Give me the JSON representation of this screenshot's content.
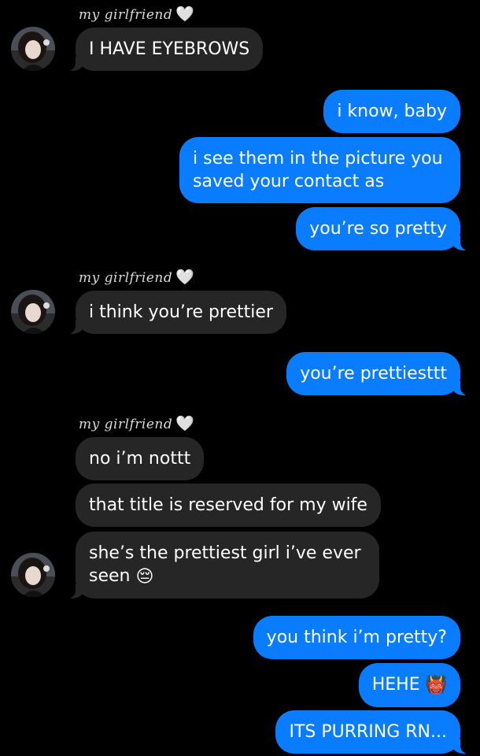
{
  "chat": {
    "sender_name": "my girlfriend",
    "heart": "🤍",
    "messages": [
      {
        "from": "them",
        "text": "I HAVE EYEBROWS"
      },
      {
        "from": "me",
        "text": "i know, baby"
      },
      {
        "from": "me",
        "text": "i see them in the picture you saved your contact as"
      },
      {
        "from": "me",
        "text": "you’re so pretty"
      },
      {
        "from": "them",
        "text": "i think you’re prettier"
      },
      {
        "from": "me",
        "text": "you’re prettiesttt"
      },
      {
        "from": "them",
        "text": "no i’m nottt"
      },
      {
        "from": "them",
        "text": "that title is reserved for my wife"
      },
      {
        "from": "them",
        "text": "she’s the prettiest girl i’ve ever seen",
        "emoji": "😔"
      },
      {
        "from": "me",
        "text": "you think i’m pretty?"
      },
      {
        "from": "me",
        "text": "HEHE",
        "emoji": "👹"
      },
      {
        "from": "me",
        "text": "ITS PURRING RN..."
      }
    ]
  },
  "colors": {
    "background": "#000000",
    "incoming_bubble": "#262626",
    "outgoing_bubble": "#0a7cff",
    "text": "#ffffff"
  },
  "icons": {
    "avatar": "contact-avatar-photo"
  }
}
